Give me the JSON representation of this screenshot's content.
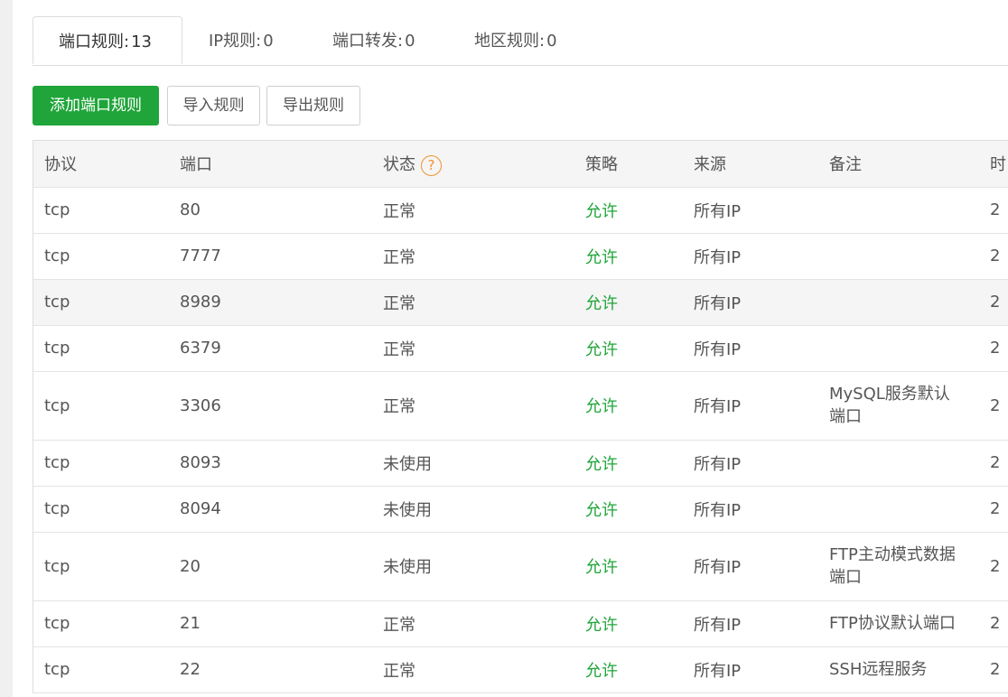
{
  "tabs": [
    {
      "label": "端口规则:",
      "count": "13",
      "active": true
    },
    {
      "label": "IP规则:",
      "count": "0",
      "active": false
    },
    {
      "label": "端口转发:",
      "count": "0",
      "active": false
    },
    {
      "label": "地区规则:",
      "count": "0",
      "active": false
    }
  ],
  "toolbar": {
    "add_label": "添加端口规则",
    "import_label": "导入规则",
    "export_label": "导出规则"
  },
  "table": {
    "headers": [
      "协议",
      "端口",
      "状态",
      "策略",
      "来源",
      "备注",
      "时"
    ],
    "help_glyph": "?",
    "rows": [
      {
        "protocol": "tcp",
        "port": "80",
        "status": "正常",
        "policy": "允许",
        "source": "所有IP",
        "note": "",
        "time": "2"
      },
      {
        "protocol": "tcp",
        "port": "7777",
        "status": "正常",
        "policy": "允许",
        "source": "所有IP",
        "note": "",
        "time": "2"
      },
      {
        "protocol": "tcp",
        "port": "8989",
        "status": "正常",
        "policy": "允许",
        "source": "所有IP",
        "note": "",
        "time": "2"
      },
      {
        "protocol": "tcp",
        "port": "6379",
        "status": "正常",
        "policy": "允许",
        "source": "所有IP",
        "note": "",
        "time": "2"
      },
      {
        "protocol": "tcp",
        "port": "3306",
        "status": "正常",
        "policy": "允许",
        "source": "所有IP",
        "note": "MySQL服务默认端口",
        "time": "2"
      },
      {
        "protocol": "tcp",
        "port": "8093",
        "status": "未使用",
        "policy": "允许",
        "source": "所有IP",
        "note": "",
        "time": "2"
      },
      {
        "protocol": "tcp",
        "port": "8094",
        "status": "未使用",
        "policy": "允许",
        "source": "所有IP",
        "note": "",
        "time": "2"
      },
      {
        "protocol": "tcp",
        "port": "20",
        "status": "未使用",
        "policy": "允许",
        "source": "所有IP",
        "note": "FTP主动模式数据端口",
        "time": "2"
      },
      {
        "protocol": "tcp",
        "port": "21",
        "status": "正常",
        "policy": "允许",
        "source": "所有IP",
        "note": "FTP协议默认端口",
        "time": "2"
      },
      {
        "protocol": "tcp",
        "port": "22",
        "status": "正常",
        "policy": "允许",
        "source": "所有IP",
        "note": "SSH远程服务",
        "time": "2"
      }
    ]
  },
  "colors": {
    "primary": "#20a53a",
    "policy_allow": "#20a53a",
    "help_icon": "#f0932b"
  }
}
